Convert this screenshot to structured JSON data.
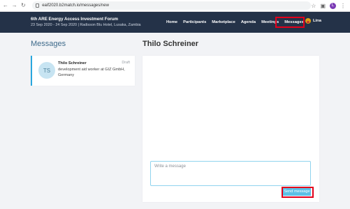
{
  "browser": {
    "back_icon": "back-arrow-icon",
    "forward_icon": "forward-arrow-icon",
    "reload_icon": "reload-icon",
    "url": "eaif2020.b2match.io/messages/new",
    "profile_initial": "L"
  },
  "header": {
    "event_title": "6th ARE Energy Access Investment Forum",
    "event_subtitle": "23 Sep 2020 - 24 Sep 2020 | Radisson Blu Hotel, Lusaka, Zambia",
    "nav": [
      {
        "label": "Home"
      },
      {
        "label": "Participants"
      },
      {
        "label": "Marketplace"
      },
      {
        "label": "Agenda"
      },
      {
        "label": "Meetings"
      },
      {
        "label": "Messages"
      }
    ],
    "active_nav": "Messages",
    "user_name": "Lina"
  },
  "left": {
    "heading": "Messages",
    "conversation": {
      "initials": "TS",
      "name": "Thilo Schreiner",
      "status": "Draft",
      "description": "development aid worker at GIZ GmbH, Germany"
    }
  },
  "right": {
    "heading": "Thilo Schreiner",
    "input_placeholder": "Write a message",
    "input_value": "",
    "send_label": "Send message"
  },
  "colors": {
    "header_bg": "#243248",
    "accent": "#29a7de",
    "send_button": "#5cc0e6",
    "highlight": "#e3001b"
  }
}
